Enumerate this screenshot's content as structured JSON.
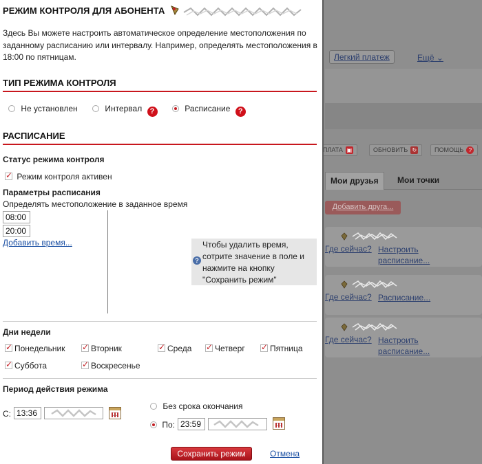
{
  "background": {
    "easy_payment": "Легкий платеж",
    "more": "Ещё",
    "toolbar": [
      {
        "label": "ОПЛАТА",
        "icon": "wallet-icon"
      },
      {
        "label": "ОБНОВИТЬ",
        "icon": "refresh-icon"
      },
      {
        "label": "ПОМОЩЬ",
        "icon": "help-icon"
      }
    ],
    "tabs": [
      "Мои друзья",
      "Мои точки"
    ],
    "add_friend": "Добавить друга...",
    "friends": [
      {
        "where": "Где сейчас?",
        "action": "Настроить расписание..."
      },
      {
        "where": "Где сейчас?",
        "action": "Расписание..."
      },
      {
        "where": "Где сейчас?",
        "action": "Настроить расписание..."
      }
    ]
  },
  "dialog": {
    "title": "РЕЖИМ КОНТРОЛЯ ДЛЯ АБОНЕНТА",
    "intro": "Здесь Вы можете настроить автоматическое определение местоположения по заданному расписанию или интервалу. Например, определять местоположения в 18:00 по пятницам.",
    "mode_section": {
      "heading": "ТИП РЕЖИМА КОНТРОЛЯ",
      "options": [
        {
          "label": "Не установлен",
          "selected": false,
          "help": false
        },
        {
          "label": "Интервал",
          "selected": false,
          "help": true
        },
        {
          "label": "Расписание",
          "selected": true,
          "help": true
        }
      ]
    },
    "schedule_section": {
      "heading": "РАСПИСАНИЕ",
      "status_title": "Статус режима контроля",
      "active_label": "Режим контроля активен",
      "active_checked": true,
      "params_title": "Параметры расписания",
      "params_desc": "Определять местоположение в заданное время",
      "times": [
        "08:00",
        "20:00"
      ],
      "add_time": "Добавить время...",
      "hint": "Чтобы удалить время, сотрите значение в поле и нажмите на кнопку \"Сохранить режим\""
    },
    "days_section": {
      "title": "Дни недели",
      "days": [
        {
          "label": "Понедельник",
          "checked": true
        },
        {
          "label": "Вторник",
          "checked": true
        },
        {
          "label": "Среда",
          "checked": true
        },
        {
          "label": "Четверг",
          "checked": true
        },
        {
          "label": "Пятница",
          "checked": true
        },
        {
          "label": "Суббота",
          "checked": true
        },
        {
          "label": "Воскресенье",
          "checked": true
        }
      ]
    },
    "period_section": {
      "title": "Период действия режима",
      "from_label": "С:",
      "from_time": "13:36",
      "no_end_label": "Без срока окончания",
      "no_end_selected": false,
      "to_label": "По:",
      "to_selected": true,
      "to_time": "23:59"
    },
    "save_button": "Сохранить режим",
    "cancel_link": "Отмена"
  }
}
